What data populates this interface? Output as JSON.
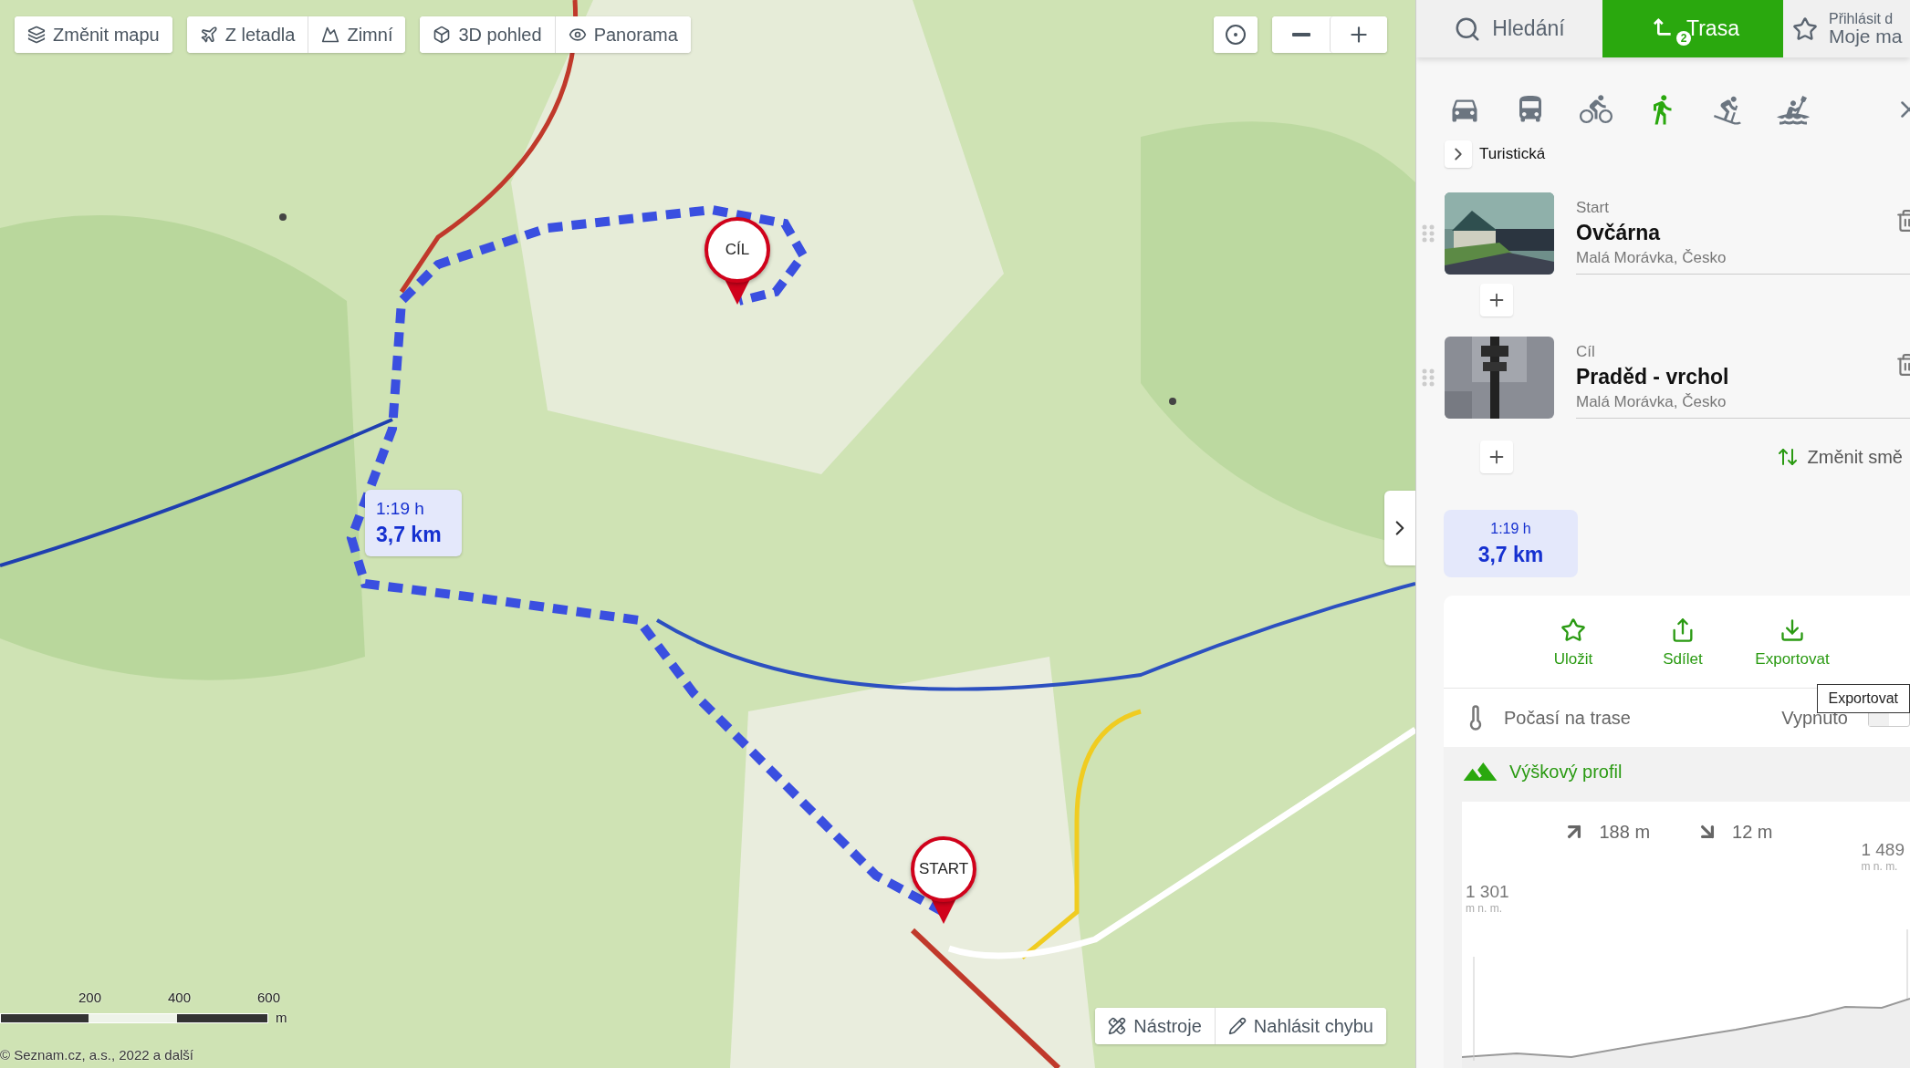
{
  "map_toolbar": [
    [
      {
        "label": "Změnit mapu",
        "kind": "layers"
      }
    ],
    [
      {
        "label": "Z letadla",
        "kind": "plane"
      },
      {
        "label": "Zimní",
        "kind": "mountain"
      }
    ],
    [
      {
        "label": "3D pohled",
        "kind": "cube"
      },
      {
        "label": "Panorama",
        "kind": "eye"
      }
    ]
  ],
  "route_markers": [
    {
      "label": "CÍL",
      "kind": "end"
    },
    {
      "label": "START",
      "kind": "start"
    }
  ],
  "route_bubble": {
    "time": "1:19 h",
    "distance": "3,7 km"
  },
  "scale_bar": {
    "ticks": [
      "200",
      "400",
      "600"
    ],
    "unit": "m"
  },
  "copyright": "© Seznam.cz, a.s., 2022 a další",
  "map_tools": [
    {
      "label": "Nástroje",
      "kind": "tools"
    },
    {
      "label": "Nahlásit chybu",
      "kind": "report"
    }
  ],
  "panel_tabs": [
    {
      "label": "Hledání",
      "kind": "search",
      "selected": false
    },
    {
      "label": "Trasa",
      "kind": "route",
      "badge": "2",
      "selected": true
    },
    {
      "label": "Moje ma",
      "sublabel": "Přihlásit d",
      "kind": "star",
      "selected": false
    }
  ],
  "transport_modes": [
    {
      "kind": "car",
      "selected": false
    },
    {
      "kind": "bus",
      "selected": false
    },
    {
      "kind": "bike",
      "selected": false
    },
    {
      "kind": "walk",
      "selected": true
    },
    {
      "kind": "ski",
      "selected": false
    },
    {
      "kind": "boat",
      "selected": false
    }
  ],
  "route_type": "Turistická",
  "waypoints": [
    {
      "role": "Start",
      "name": "Ovčárna",
      "place": "Malá Morávka, Česko",
      "kind": "building"
    },
    {
      "role": "Cíl",
      "name": "Praděd - vrchol",
      "place": "Malá Morávka, Česko",
      "kind": "sign"
    }
  ],
  "reverse_label": "Změnit smě",
  "summary": {
    "time": "1:19 h",
    "distance": "3,7 km"
  },
  "actions": [
    {
      "label": "Uložit",
      "kind": "save"
    },
    {
      "label": "Sdílet",
      "kind": "share"
    },
    {
      "label": "Exportovat",
      "kind": "export"
    }
  ],
  "tooltip": "Exportovat",
  "weather": {
    "label": "Počasí na trase",
    "status": "Vypnuto",
    "on": false
  },
  "profile": {
    "title": "Výškový profil",
    "ascent": "188 m",
    "descent": "12 m",
    "start_alt": "1 301",
    "start_unit": "m n. m.",
    "end_alt": "1 489",
    "end_unit": "m n. m."
  }
}
